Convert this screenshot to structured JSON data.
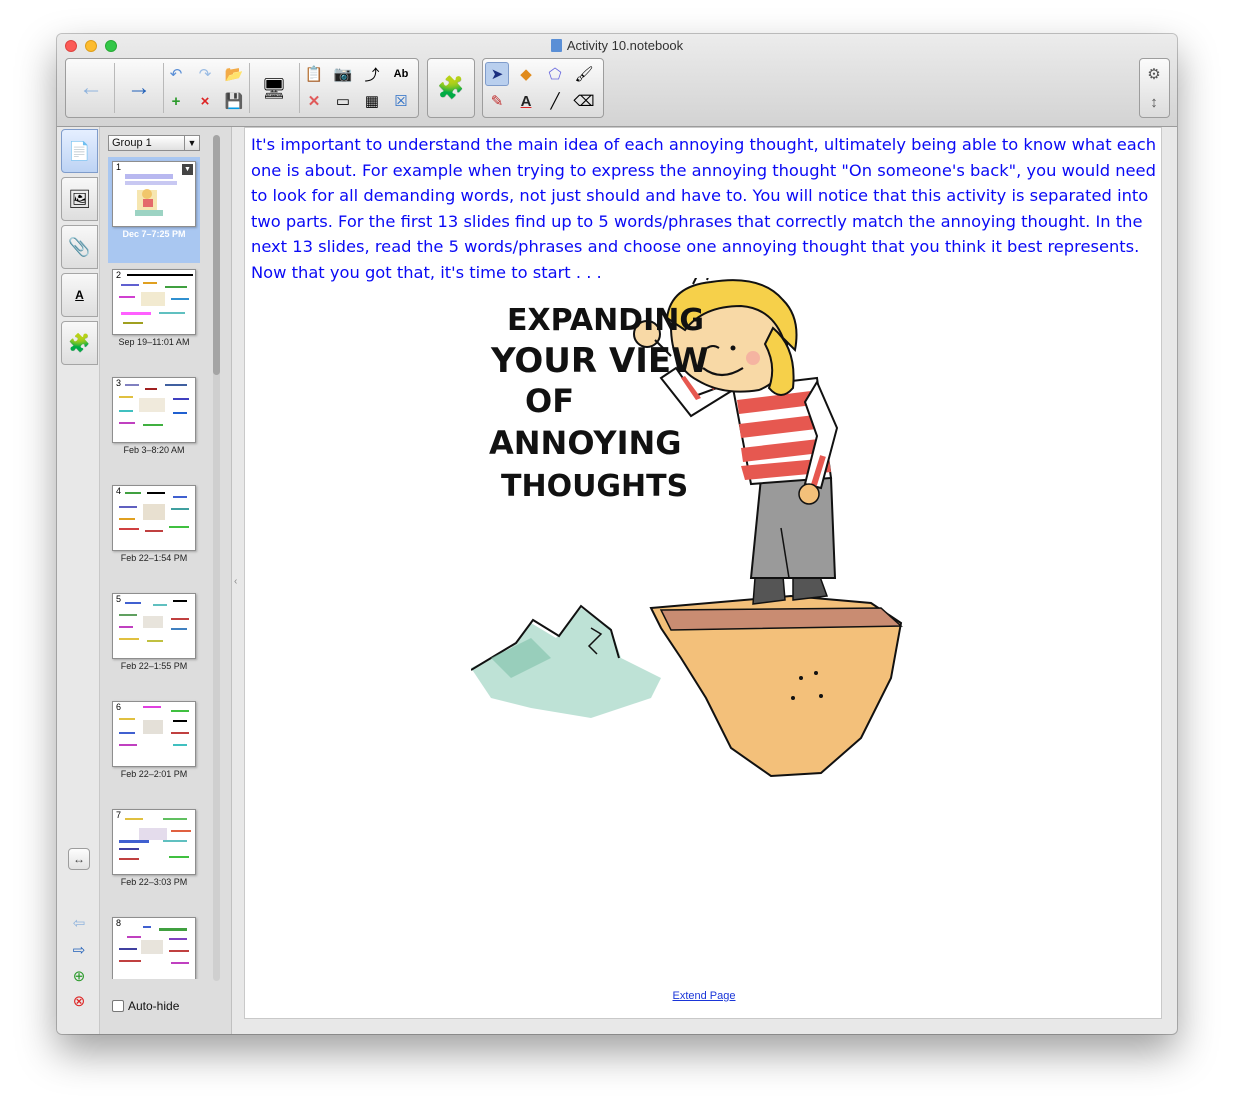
{
  "window": {
    "title": "Activity 10.notebook"
  },
  "toolbar": {
    "nav": [
      {
        "name": "previous-page-button",
        "icon": "←",
        "color": "#8fb3dd"
      },
      {
        "name": "next-page-button",
        "icon": "→",
        "color": "#1f5fb8"
      }
    ],
    "file_tools": [
      {
        "name": "undo-button",
        "icon": "↶"
      },
      {
        "name": "redo-button",
        "icon": "↷"
      },
      {
        "name": "open-file-button",
        "icon": "📂"
      },
      {
        "name": "add-page-button",
        "icon": "+"
      },
      {
        "name": "delete-page-button",
        "icon": "×"
      },
      {
        "name": "save-button",
        "icon": "💾"
      }
    ],
    "display_tool": {
      "name": "display-screen-button",
      "icon": "🖥"
    },
    "edit_tools": [
      {
        "name": "paste-button",
        "icon": "📋"
      },
      {
        "name": "screen-capture-button",
        "icon": "📷"
      },
      {
        "name": "rotate-button",
        "icon": "⤴"
      },
      {
        "name": "spell-check-button",
        "icon": "Ab"
      },
      {
        "name": "delete-button",
        "icon": "✕"
      },
      {
        "name": "screen-shade-button",
        "icon": "▭"
      },
      {
        "name": "insert-table-button",
        "icon": "▦"
      },
      {
        "name": "close-button",
        "icon": "☒"
      }
    ],
    "addon_tool": {
      "name": "addons-button",
      "icon": "🧩"
    },
    "draw_tools": [
      {
        "name": "select-tool-button",
        "icon": "➤",
        "active": true
      },
      {
        "name": "shapes-tool-button",
        "icon": "◆"
      },
      {
        "name": "eraser-shape-button",
        "icon": "⬠"
      },
      {
        "name": "fill-tool-button",
        "icon": "🖌"
      },
      {
        "name": "pens-tool-button",
        "icon": "✎"
      },
      {
        "name": "text-tool-button",
        "icon": "A"
      },
      {
        "name": "line-tool-button",
        "icon": "╱"
      },
      {
        "name": "eraser-tool-button",
        "icon": "⌫"
      }
    ],
    "right_tools": [
      {
        "name": "settings-button",
        "icon": "⚙"
      },
      {
        "name": "toolbar-position-button",
        "icon": "↕"
      }
    ]
  },
  "side_tabs": [
    {
      "name": "page-sorter-tab",
      "icon": "📄",
      "active": true
    },
    {
      "name": "gallery-tab",
      "icon": "🖼"
    },
    {
      "name": "attachments-tab",
      "icon": "📎"
    },
    {
      "name": "properties-tab",
      "icon": "A"
    },
    {
      "name": "addons-tab",
      "icon": "🧩"
    }
  ],
  "side_controls": {
    "resize_icon": "↔",
    "prev_icon": "⇦",
    "next_icon": "⇨",
    "add_icon": "⊕",
    "delete_icon": "⊗"
  },
  "page_sorter": {
    "group_label": "Group 1",
    "auto_hide_label": "Auto-hide",
    "pages": [
      {
        "num": "1",
        "date": "Dec 7–7:25 PM",
        "selected": true
      },
      {
        "num": "2",
        "date": "Sep 19–11:01 AM"
      },
      {
        "num": "3",
        "date": "Feb 3–8:20 AM"
      },
      {
        "num": "4",
        "date": "Feb 22–1:54 PM"
      },
      {
        "num": "5",
        "date": "Feb 22–1:55 PM"
      },
      {
        "num": "6",
        "date": "Feb 22–2:01 PM"
      },
      {
        "num": "7",
        "date": "Feb 22–3:03 PM"
      },
      {
        "num": "8",
        "date": ""
      }
    ]
  },
  "page": {
    "intro_text": "It's important to understand the main idea of each annoying thought, ultimately being able to know what each one is about.  For example when trying to express the annoying thought \"On someone's back\", you would need to look for all demanding words, not just should and have to.  You will notice that this activity is separated into two parts.  For the first 13 slides find up to 5 words/phrases that correctly match the annoying thought.  In the next 13 slides, read the 5 words/phrases and choose one annoying thought that you think it best represents.  Now that you got that, it's time to start . . .",
    "cartoon_lines": [
      "EXPANDING",
      "YOUR VIEW",
      "OF",
      "ANNOYING",
      "THOUGHTS"
    ],
    "extend_link": "Extend Page"
  },
  "colors": {
    "text_blue": "#0a0af5",
    "selected_page": "#a9c7f1",
    "link": "#1a35d8"
  }
}
